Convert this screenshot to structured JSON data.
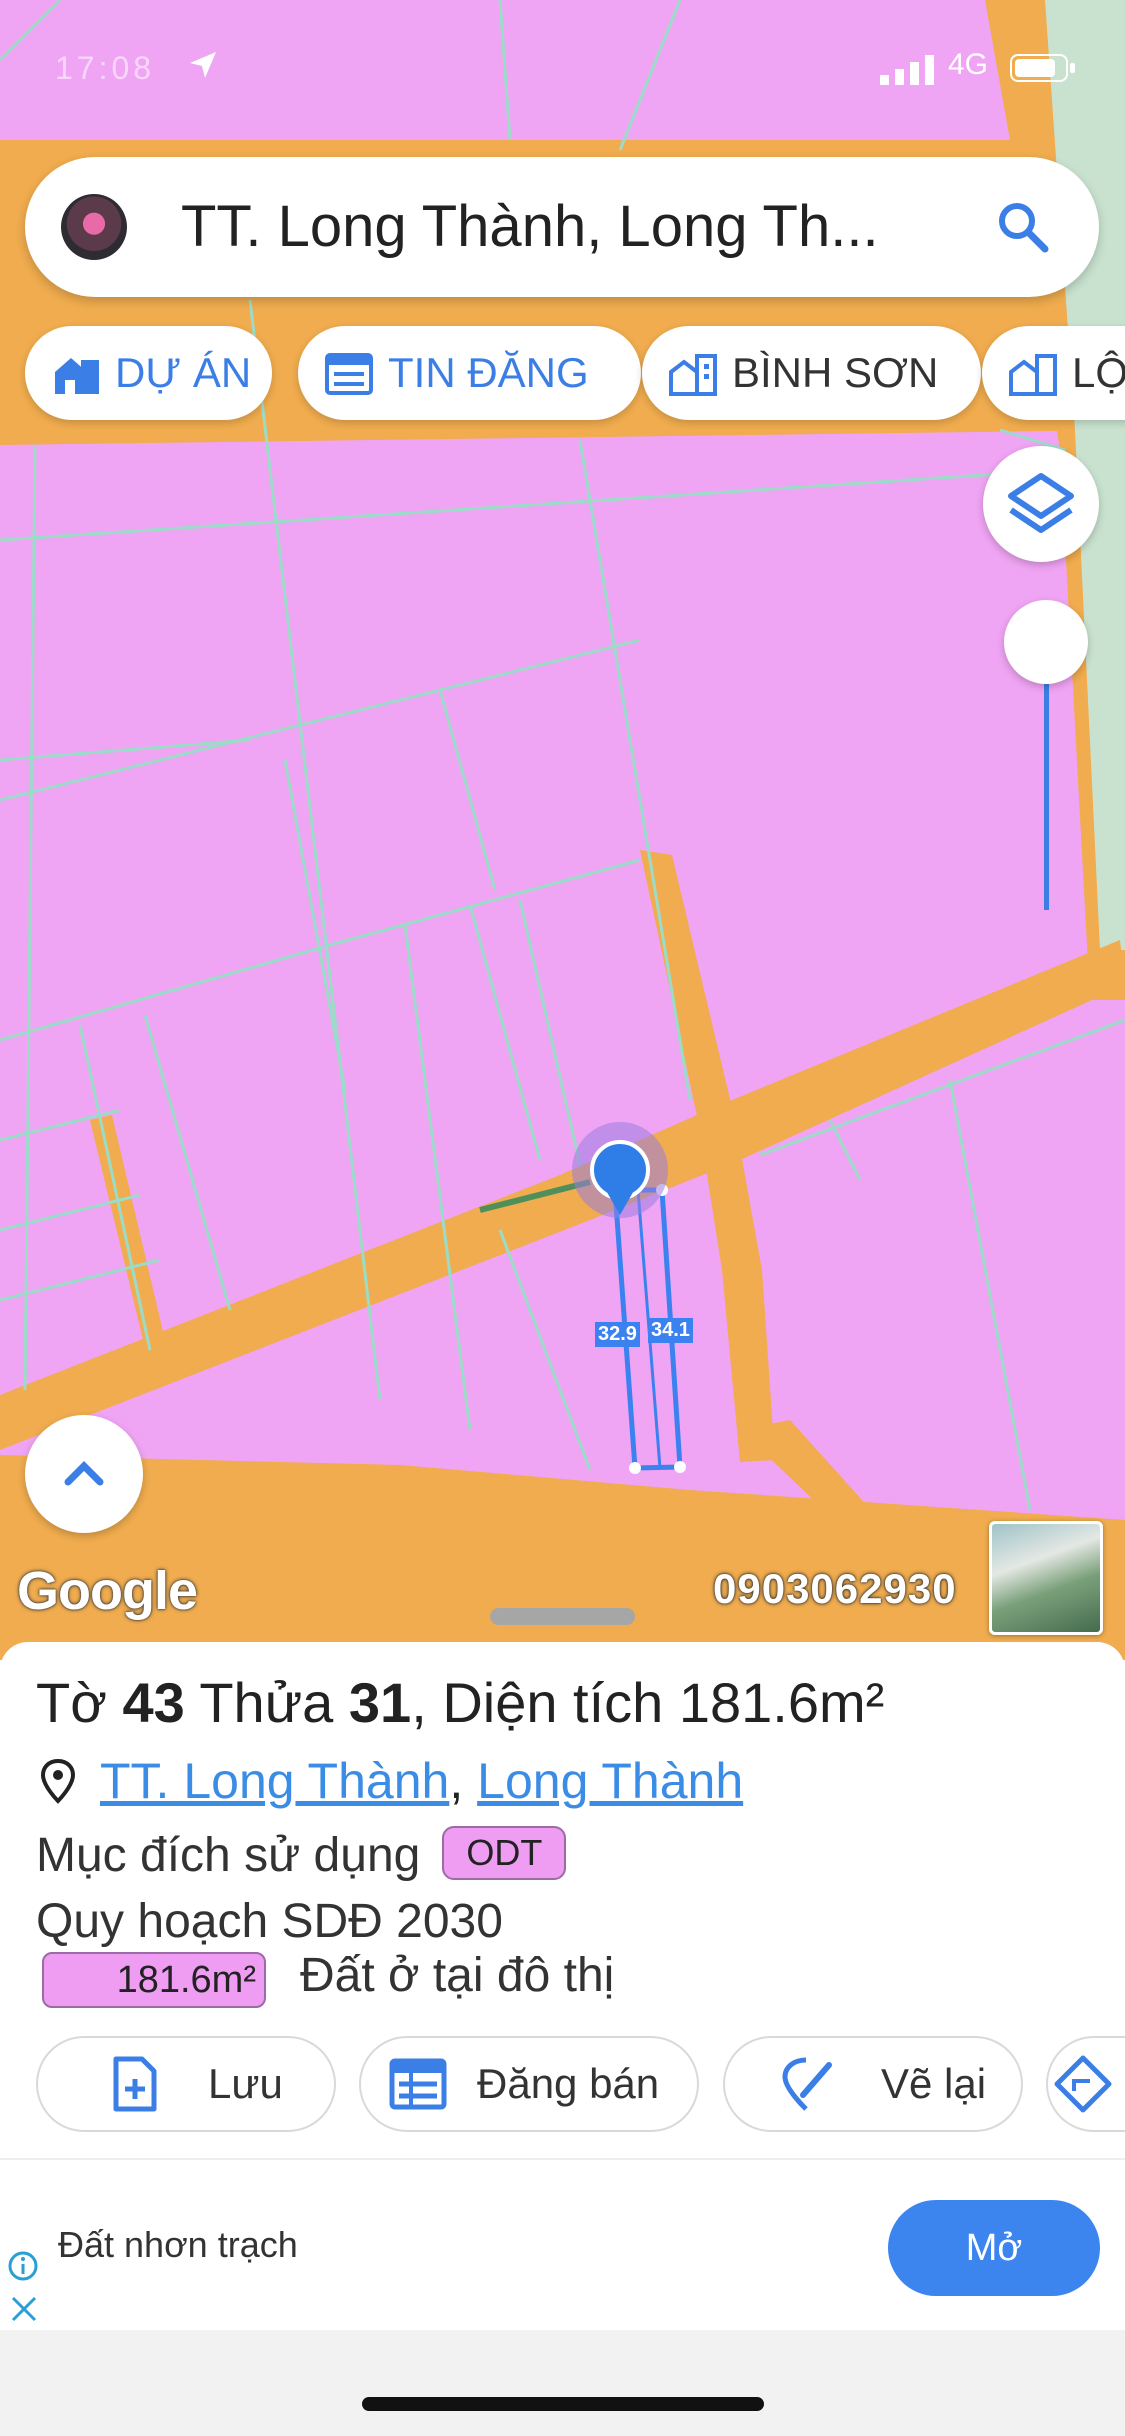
{
  "status_bar": {
    "time": "17:08",
    "network": "4G"
  },
  "search": {
    "title": "TT. Long Thành, Long Th..."
  },
  "chips": [
    {
      "label": "DỰ ÁN",
      "icon": "building-icon"
    },
    {
      "label": "TIN ĐĂNG",
      "icon": "calendar-list-icon"
    },
    {
      "label": "BÌNH SƠN",
      "icon": "city-icon"
    },
    {
      "label": "LỘC",
      "icon": "city-icon"
    }
  ],
  "map": {
    "plot_labels": {
      "left": "32.9",
      "right": "34.1"
    },
    "google_mark": "Google",
    "phone": "0903062930",
    "colors": {
      "land": "#f0a4f4",
      "road": "#f0ac4e",
      "boundary": "#9bdcc8",
      "plot": "#3b82f0"
    }
  },
  "parcel": {
    "line1": {
      "to_label": "Tờ",
      "to_value": "43",
      "thua_label": "Thửa",
      "thua_value": "31",
      "area_label": "Diện tích",
      "area_value": "181.6m²"
    },
    "location": {
      "ward": "TT. Long Thành",
      "separator": ",",
      "district": "Long Thành"
    },
    "purpose": {
      "label": "Mục đích sử dụng",
      "code": "ODT"
    },
    "planning": {
      "label": "Quy hoạch SDĐ 2030"
    },
    "zone": {
      "area": "181.6m²",
      "description": "Đất ở tại đô thị"
    }
  },
  "actions": {
    "save": "Lưu",
    "post_sale": "Đăng bán",
    "redraw": "Vẽ lại"
  },
  "ad": {
    "text": "Đất nhơn trạch",
    "button": "Mở"
  }
}
